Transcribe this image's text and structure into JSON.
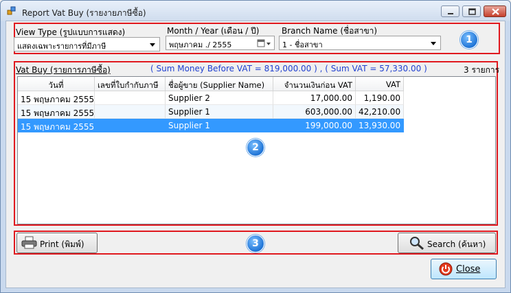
{
  "window": {
    "title": "Report Vat Buy (รายงายภาษีซื้อ)"
  },
  "filters": {
    "view_type_label": "View Type (รูปแบบการแสดง)",
    "view_type_value": "แสดงเฉพาะรายการที่มีภาษี",
    "month_year_label": "Month / Year (เดือน / ปี)",
    "month_year_value": "พฤษภาคม ./  2555",
    "branch_label": "Branch Name (ชื่อสาขา)",
    "branch_value": "1 - ชื่อสาขา",
    "badge": "1"
  },
  "summary": {
    "section_title": "Vat Buy (รายการภาษีซื้อ)",
    "totals": "( Sum Money Before VAT = 819,000.00 ) , ( Sum VAT = 57,330.00 )",
    "count": "3 รายการ",
    "accent_color": "#1f3fd0"
  },
  "table": {
    "columns": [
      "วันที่",
      "เลขที่ใบกำกับภาษี",
      "ชื่อผู้ขาย  (Supplier Name)",
      "จำนวนเงินก่อน VAT",
      "VAT"
    ],
    "rows": [
      [
        "15 พฤษภาคม  2555",
        "",
        "Supplier 2",
        "17,000.00",
        "1,190.00"
      ],
      [
        "15 พฤษภาคม  2555",
        "",
        "Supplier 1",
        "603,000.00",
        "42,210.00"
      ],
      [
        "15 พฤษภาคม  2555",
        "",
        "Supplier 1",
        "199,000.00",
        "13,930.00"
      ]
    ],
    "selected_row": 2,
    "badge": "2"
  },
  "actions": {
    "print_label": "Print (พิมพ์)",
    "search_label": "Search (ค้นหา)",
    "close_label": "Close",
    "badge": "3"
  },
  "icons": [
    "app-icon",
    "minimize-icon",
    "maximize-icon",
    "close-window-icon",
    "calendar-icon",
    "printer-icon",
    "magnifier-icon",
    "power-icon"
  ]
}
